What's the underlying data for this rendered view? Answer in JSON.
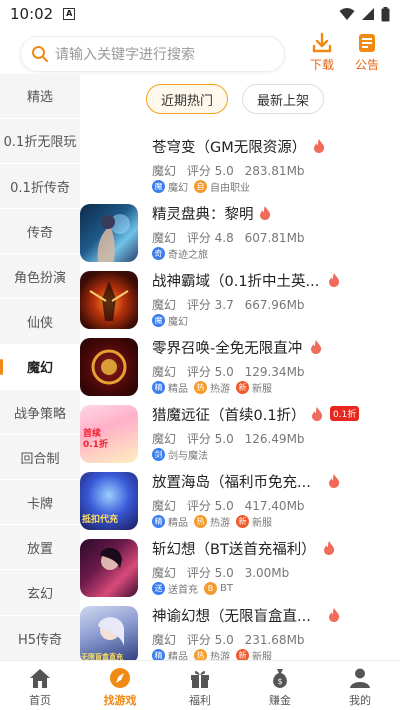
{
  "status": {
    "time": "10:02",
    "a_glyph": "A"
  },
  "search": {
    "placeholder": "请输入关键字进行搜索"
  },
  "actions": {
    "download": "下载",
    "notice": "公告"
  },
  "sidebar": {
    "items": [
      {
        "label": "精选"
      },
      {
        "label": "0.1折无限玩"
      },
      {
        "label": "0.1折传奇"
      },
      {
        "label": "传奇"
      },
      {
        "label": "角色扮演"
      },
      {
        "label": "仙侠"
      },
      {
        "label": "魔幻"
      },
      {
        "label": "战争策略"
      },
      {
        "label": "回合制"
      },
      {
        "label": "卡牌"
      },
      {
        "label": "放置"
      },
      {
        "label": "玄幻"
      },
      {
        "label": "H5传奇"
      }
    ]
  },
  "tabs": [
    {
      "label": "近期热门"
    },
    {
      "label": "最新上架"
    }
  ],
  "games": [
    {
      "title": "苍穹变（GM无限资源）",
      "genre": "魔幻",
      "score": "评分 5.0",
      "size": "283.81Mb",
      "tags": [
        {
          "icon": "魔",
          "text": "魔幻",
          "color": "#3b7df0"
        },
        {
          "icon": "自",
          "text": "自由职业",
          "color": "#f39a2c"
        }
      ]
    },
    {
      "title": "精灵盘典：黎明",
      "genre": "魔幻",
      "score": "评分 4.8",
      "size": "607.81Mb",
      "tags": [
        {
          "icon": "奇",
          "text": "奇迹之旅",
          "color": "#3b7df0"
        }
      ]
    },
    {
      "title": "战神霸域（0.1折中土英...",
      "genre": "魔幻",
      "score": "评分 3.7",
      "size": "667.96Mb",
      "tags": [
        {
          "icon": "魔",
          "text": "魔幻",
          "color": "#3b7df0"
        }
      ]
    },
    {
      "title": "零界召唤-全免无限直冲",
      "genre": "魔幻",
      "score": "评分 5.0",
      "size": "129.34Mb",
      "tags": [
        {
          "icon": "精",
          "text": "精品",
          "color": "#3b7df0"
        },
        {
          "icon": "热",
          "text": "热游",
          "color": "#f39a2c"
        },
        {
          "icon": "新",
          "text": "新服",
          "color": "#ee5a2a"
        }
      ]
    },
    {
      "title": "猎魔远征（首续0.1折）",
      "genre": "魔幻",
      "score": "评分 5.0",
      "size": "126.49Mb",
      "badge": "0.1折",
      "tags": [
        {
          "icon": "剑",
          "text": "剑与魔法",
          "color": "#3b7df0"
        }
      ]
    },
    {
      "title": "放置海岛（福利币免充...",
      "genre": "魔幻",
      "score": "评分 5.0",
      "size": "417.40Mb",
      "tags": [
        {
          "icon": "精",
          "text": "精品",
          "color": "#3b7df0"
        },
        {
          "icon": "热",
          "text": "热游",
          "color": "#f39a2c"
        },
        {
          "icon": "新",
          "text": "新服",
          "color": "#ee5a2a"
        }
      ]
    },
    {
      "title": "斩幻想（BT送首充福利）",
      "genre": "魔幻",
      "score": "评分 5.0",
      "size": "3.00Mb",
      "tags": [
        {
          "icon": "送",
          "text": "送首充",
          "color": "#3b7df0"
        },
        {
          "icon": "B",
          "text": "BT",
          "color": "#f39a2c"
        }
      ]
    },
    {
      "title": "神谕幻想（无限盲盒直...",
      "genre": "魔幻",
      "score": "评分 5.0",
      "size": "231.68Mb",
      "tags": [
        {
          "icon": "精",
          "text": "精品",
          "color": "#3b7df0"
        },
        {
          "icon": "热",
          "text": "热游",
          "color": "#f39a2c"
        },
        {
          "icon": "新",
          "text": "新服",
          "color": "#ee5a2a"
        }
      ]
    }
  ],
  "thumb_texts": {
    "g4": "首续\n0.1折",
    "g5": "抵扣代充",
    "g7": "无限盲盒直充"
  },
  "tabbar": [
    {
      "label": "首页"
    },
    {
      "label": "找游戏"
    },
    {
      "label": "福利"
    },
    {
      "label": "赚金"
    },
    {
      "label": "我的"
    }
  ],
  "colors": {
    "accent": "#f08a14",
    "fire": "#f06b5a",
    "blue_tag": "#3b7df0"
  }
}
